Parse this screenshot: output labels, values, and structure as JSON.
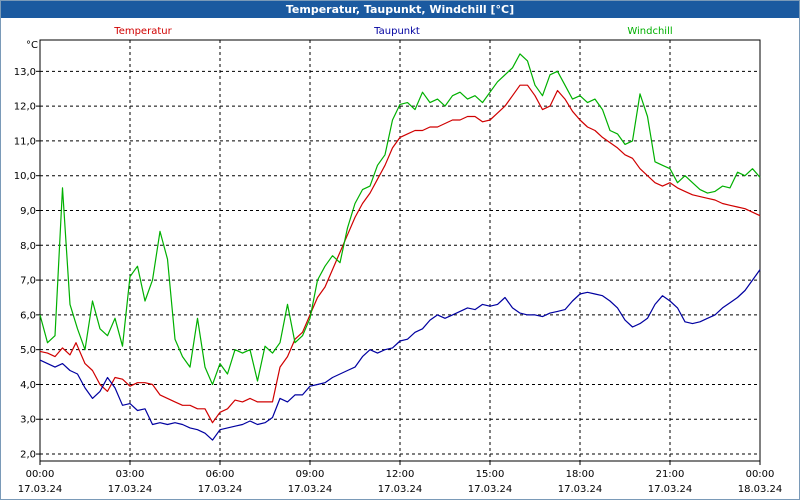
{
  "window": {
    "title": "Temperatur, Taupunkt, Windchill [°C]"
  },
  "colors": {
    "temperatur": "#d00000",
    "taupunkt": "#0000a0",
    "windchill": "#00b000",
    "titlebar": "#1b5aa0"
  },
  "chart_data": {
    "type": "line",
    "title": "Temperatur, Taupunkt, Windchill [°C]",
    "ylabel": "°C",
    "xlabel": "",
    "x_unit": "hours from 00:00 17.03.24",
    "xlim": [
      0,
      24
    ],
    "ylim": [
      1.8,
      13.9
    ],
    "grid": true,
    "legend_placement": "top",
    "y_ticks": [
      "2,0",
      "3,0",
      "4,0",
      "5,0",
      "6,0",
      "7,0",
      "8,0",
      "9,0",
      "10,0",
      "11,0",
      "12,0",
      "13,0"
    ],
    "x_ticks": [
      {
        "time": "00:00",
        "date": "17.03.24"
      },
      {
        "time": "03:00",
        "date": "17.03.24"
      },
      {
        "time": "06:00",
        "date": "17.03.24"
      },
      {
        "time": "09:00",
        "date": "17.03.24"
      },
      {
        "time": "12:00",
        "date": "17.03.24"
      },
      {
        "time": "15:00",
        "date": "17.03.24"
      },
      {
        "time": "18:00",
        "date": "17.03.24"
      },
      {
        "time": "21:00",
        "date": "17.03.24"
      },
      {
        "time": "00:00",
        "date": "18.03.24"
      }
    ],
    "series": [
      {
        "name": "Temperatur",
        "color": "#d00000",
        "points": [
          [
            0,
            4.95
          ],
          [
            0.25,
            4.9
          ],
          [
            0.5,
            4.8
          ],
          [
            0.75,
            5.05
          ],
          [
            1.0,
            4.85
          ],
          [
            1.2,
            5.2
          ],
          [
            1.5,
            4.6
          ],
          [
            1.75,
            4.4
          ],
          [
            2.0,
            4.0
          ],
          [
            2.25,
            3.8
          ],
          [
            2.5,
            4.2
          ],
          [
            2.75,
            4.15
          ],
          [
            3.0,
            3.95
          ],
          [
            3.25,
            4.05
          ],
          [
            3.5,
            4.05
          ],
          [
            3.75,
            4.0
          ],
          [
            4.0,
            3.7
          ],
          [
            4.25,
            3.6
          ],
          [
            4.5,
            3.5
          ],
          [
            4.75,
            3.4
          ],
          [
            5.0,
            3.4
          ],
          [
            5.25,
            3.3
          ],
          [
            5.5,
            3.3
          ],
          [
            5.75,
            2.9
          ],
          [
            6.0,
            3.2
          ],
          [
            6.25,
            3.3
          ],
          [
            6.5,
            3.55
          ],
          [
            6.75,
            3.5
          ],
          [
            7.0,
            3.6
          ],
          [
            7.25,
            3.5
          ],
          [
            7.5,
            3.5
          ],
          [
            7.75,
            3.5
          ],
          [
            8.0,
            4.5
          ],
          [
            8.25,
            4.8
          ],
          [
            8.5,
            5.3
          ],
          [
            8.75,
            5.5
          ],
          [
            9.0,
            6.0
          ],
          [
            9.25,
            6.5
          ],
          [
            9.5,
            6.8
          ],
          [
            9.75,
            7.3
          ],
          [
            10.0,
            7.8
          ],
          [
            10.25,
            8.3
          ],
          [
            10.5,
            8.8
          ],
          [
            10.75,
            9.2
          ],
          [
            11.0,
            9.5
          ],
          [
            11.25,
            9.9
          ],
          [
            11.5,
            10.3
          ],
          [
            11.75,
            10.8
          ],
          [
            12.0,
            11.1
          ],
          [
            12.25,
            11.2
          ],
          [
            12.5,
            11.3
          ],
          [
            12.75,
            11.3
          ],
          [
            13.0,
            11.4
          ],
          [
            13.25,
            11.4
          ],
          [
            13.5,
            11.5
          ],
          [
            13.75,
            11.6
          ],
          [
            14.0,
            11.6
          ],
          [
            14.25,
            11.7
          ],
          [
            14.5,
            11.7
          ],
          [
            14.75,
            11.55
          ],
          [
            15.0,
            11.6
          ],
          [
            15.25,
            11.8
          ],
          [
            15.5,
            12.0
          ],
          [
            15.75,
            12.3
          ],
          [
            16.0,
            12.6
          ],
          [
            16.25,
            12.6
          ],
          [
            16.5,
            12.3
          ],
          [
            16.75,
            11.9
          ],
          [
            17.0,
            12.0
          ],
          [
            17.25,
            12.45
          ],
          [
            17.5,
            12.2
          ],
          [
            17.75,
            11.85
          ],
          [
            18.0,
            11.6
          ],
          [
            18.25,
            11.4
          ],
          [
            18.5,
            11.3
          ],
          [
            18.75,
            11.1
          ],
          [
            19.0,
            10.95
          ],
          [
            19.25,
            10.8
          ],
          [
            19.5,
            10.6
          ],
          [
            19.75,
            10.5
          ],
          [
            20.0,
            10.2
          ],
          [
            20.25,
            10.0
          ],
          [
            20.5,
            9.8
          ],
          [
            20.75,
            9.7
          ],
          [
            21.0,
            9.8
          ],
          [
            21.25,
            9.65
          ],
          [
            21.5,
            9.55
          ],
          [
            21.75,
            9.45
          ],
          [
            22.0,
            9.4
          ],
          [
            22.25,
            9.35
          ],
          [
            22.5,
            9.3
          ],
          [
            22.75,
            9.2
          ],
          [
            23.0,
            9.15
          ],
          [
            23.25,
            9.1
          ],
          [
            23.5,
            9.05
          ],
          [
            23.75,
            8.95
          ],
          [
            24.0,
            8.85
          ]
        ]
      },
      {
        "name": "Taupunkt",
        "color": "#0000a0",
        "points": [
          [
            0,
            4.7
          ],
          [
            0.25,
            4.6
          ],
          [
            0.5,
            4.5
          ],
          [
            0.75,
            4.6
          ],
          [
            1.0,
            4.4
          ],
          [
            1.25,
            4.3
          ],
          [
            1.5,
            3.9
          ],
          [
            1.75,
            3.6
          ],
          [
            2.0,
            3.8
          ],
          [
            2.25,
            4.2
          ],
          [
            2.5,
            3.9
          ],
          [
            2.75,
            3.4
          ],
          [
            3.0,
            3.45
          ],
          [
            3.25,
            3.25
          ],
          [
            3.5,
            3.3
          ],
          [
            3.75,
            2.85
          ],
          [
            4.0,
            2.9
          ],
          [
            4.25,
            2.85
          ],
          [
            4.5,
            2.9
          ],
          [
            4.75,
            2.85
          ],
          [
            5.0,
            2.75
          ],
          [
            5.25,
            2.7
          ],
          [
            5.5,
            2.6
          ],
          [
            5.75,
            2.4
          ],
          [
            6.0,
            2.7
          ],
          [
            6.25,
            2.75
          ],
          [
            6.5,
            2.8
          ],
          [
            6.75,
            2.85
          ],
          [
            7.0,
            2.95
          ],
          [
            7.25,
            2.85
          ],
          [
            7.5,
            2.9
          ],
          [
            7.75,
            3.05
          ],
          [
            8.0,
            3.6
          ],
          [
            8.25,
            3.5
          ],
          [
            8.5,
            3.7
          ],
          [
            8.75,
            3.7
          ],
          [
            9.0,
            3.95
          ],
          [
            9.25,
            4.0
          ],
          [
            9.5,
            4.05
          ],
          [
            9.75,
            4.2
          ],
          [
            10.0,
            4.3
          ],
          [
            10.25,
            4.4
          ],
          [
            10.5,
            4.5
          ],
          [
            10.75,
            4.8
          ],
          [
            11.0,
            5.0
          ],
          [
            11.25,
            4.9
          ],
          [
            11.5,
            5.0
          ],
          [
            11.75,
            5.05
          ],
          [
            12.0,
            5.25
          ],
          [
            12.25,
            5.3
          ],
          [
            12.5,
            5.5
          ],
          [
            12.75,
            5.6
          ],
          [
            13.0,
            5.85
          ],
          [
            13.25,
            6.0
          ],
          [
            13.5,
            5.9
          ],
          [
            13.75,
            6.0
          ],
          [
            14.0,
            6.1
          ],
          [
            14.25,
            6.2
          ],
          [
            14.5,
            6.15
          ],
          [
            14.75,
            6.3
          ],
          [
            15.0,
            6.25
          ],
          [
            15.25,
            6.3
          ],
          [
            15.5,
            6.5
          ],
          [
            15.75,
            6.2
          ],
          [
            16.0,
            6.05
          ],
          [
            16.25,
            6.0
          ],
          [
            16.5,
            6.0
          ],
          [
            16.75,
            5.95
          ],
          [
            17.0,
            6.05
          ],
          [
            17.25,
            6.1
          ],
          [
            17.5,
            6.15
          ],
          [
            17.75,
            6.4
          ],
          [
            18.0,
            6.6
          ],
          [
            18.25,
            6.65
          ],
          [
            18.5,
            6.6
          ],
          [
            18.75,
            6.55
          ],
          [
            19.0,
            6.4
          ],
          [
            19.25,
            6.2
          ],
          [
            19.5,
            5.85
          ],
          [
            19.75,
            5.65
          ],
          [
            20.0,
            5.75
          ],
          [
            20.25,
            5.9
          ],
          [
            20.5,
            6.3
          ],
          [
            20.75,
            6.55
          ],
          [
            21.0,
            6.4
          ],
          [
            21.25,
            6.2
          ],
          [
            21.5,
            5.8
          ],
          [
            21.75,
            5.75
          ],
          [
            22.0,
            5.8
          ],
          [
            22.25,
            5.9
          ],
          [
            22.5,
            6.0
          ],
          [
            22.75,
            6.2
          ],
          [
            23.0,
            6.35
          ],
          [
            23.25,
            6.5
          ],
          [
            23.5,
            6.7
          ],
          [
            23.75,
            7.0
          ],
          [
            24.0,
            7.3
          ]
        ]
      },
      {
        "name": "Windchill",
        "color": "#00b000",
        "points": [
          [
            0,
            6.0
          ],
          [
            0.25,
            5.2
          ],
          [
            0.5,
            5.4
          ],
          [
            0.75,
            9.65
          ],
          [
            1.0,
            6.3
          ],
          [
            1.25,
            5.6
          ],
          [
            1.5,
            5.0
          ],
          [
            1.75,
            6.4
          ],
          [
            2.0,
            5.6
          ],
          [
            2.25,
            5.4
          ],
          [
            2.5,
            5.9
          ],
          [
            2.75,
            5.1
          ],
          [
            3.0,
            7.1
          ],
          [
            3.25,
            7.4
          ],
          [
            3.5,
            6.4
          ],
          [
            3.75,
            7.0
          ],
          [
            4.0,
            8.4
          ],
          [
            4.25,
            7.6
          ],
          [
            4.5,
            5.3
          ],
          [
            4.75,
            4.8
          ],
          [
            5.0,
            4.5
          ],
          [
            5.25,
            5.9
          ],
          [
            5.5,
            4.5
          ],
          [
            5.75,
            4.0
          ],
          [
            6.0,
            4.6
          ],
          [
            6.25,
            4.3
          ],
          [
            6.5,
            5.0
          ],
          [
            6.75,
            4.9
          ],
          [
            7.0,
            5.0
          ],
          [
            7.25,
            4.1
          ],
          [
            7.5,
            5.1
          ],
          [
            7.75,
            4.9
          ],
          [
            8.0,
            5.2
          ],
          [
            8.25,
            6.3
          ],
          [
            8.5,
            5.2
          ],
          [
            8.75,
            5.4
          ],
          [
            9.0,
            5.9
          ],
          [
            9.25,
            7.0
          ],
          [
            9.5,
            7.4
          ],
          [
            9.75,
            7.7
          ],
          [
            10.0,
            7.5
          ],
          [
            10.25,
            8.5
          ],
          [
            10.5,
            9.2
          ],
          [
            10.75,
            9.6
          ],
          [
            11.0,
            9.7
          ],
          [
            11.25,
            10.3
          ],
          [
            11.5,
            10.6
          ],
          [
            11.75,
            11.6
          ],
          [
            12.0,
            12.05
          ],
          [
            12.25,
            12.1
          ],
          [
            12.5,
            11.9
          ],
          [
            12.75,
            12.4
          ],
          [
            13.0,
            12.1
          ],
          [
            13.25,
            12.2
          ],
          [
            13.5,
            12.0
          ],
          [
            13.75,
            12.3
          ],
          [
            14.0,
            12.4
          ],
          [
            14.25,
            12.2
          ],
          [
            14.5,
            12.3
          ],
          [
            14.75,
            12.1
          ],
          [
            15.0,
            12.4
          ],
          [
            15.25,
            12.7
          ],
          [
            15.5,
            12.9
          ],
          [
            15.75,
            13.1
          ],
          [
            16.0,
            13.5
          ],
          [
            16.25,
            13.3
          ],
          [
            16.5,
            12.6
          ],
          [
            16.75,
            12.3
          ],
          [
            17.0,
            12.9
          ],
          [
            17.25,
            13.0
          ],
          [
            17.5,
            12.6
          ],
          [
            17.75,
            12.2
          ],
          [
            18.0,
            12.3
          ],
          [
            18.25,
            12.1
          ],
          [
            18.5,
            12.2
          ],
          [
            18.75,
            11.9
          ],
          [
            19.0,
            11.3
          ],
          [
            19.25,
            11.2
          ],
          [
            19.5,
            10.9
          ],
          [
            19.75,
            11.0
          ],
          [
            20.0,
            12.35
          ],
          [
            20.25,
            11.7
          ],
          [
            20.5,
            10.4
          ],
          [
            20.75,
            10.3
          ],
          [
            21.0,
            10.2
          ],
          [
            21.25,
            9.8
          ],
          [
            21.5,
            10.0
          ],
          [
            21.75,
            9.8
          ],
          [
            22.0,
            9.6
          ],
          [
            22.25,
            9.5
          ],
          [
            22.5,
            9.55
          ],
          [
            22.75,
            9.7
          ],
          [
            23.0,
            9.65
          ],
          [
            23.25,
            10.1
          ],
          [
            23.5,
            10.0
          ],
          [
            23.75,
            10.2
          ],
          [
            24.0,
            9.95
          ]
        ]
      }
    ]
  }
}
